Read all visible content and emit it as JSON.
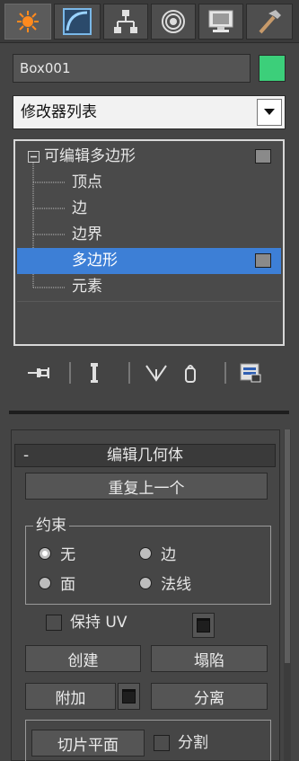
{
  "tabs": [
    {
      "icon": "create-sun-icon",
      "active": true
    },
    {
      "icon": "modify-curve-icon",
      "active": false
    },
    {
      "icon": "hierarchy-icon",
      "active": false
    },
    {
      "icon": "motion-target-icon",
      "active": false
    },
    {
      "icon": "display-monitor-icon",
      "active": false
    },
    {
      "icon": "utilities-hammer-icon",
      "active": false
    }
  ],
  "object": {
    "name": "Box001",
    "color": "#3ccf7a"
  },
  "modifier_list": {
    "label": "修改器列表"
  },
  "stack": {
    "root": "可编辑多边形",
    "items": [
      "顶点",
      "边",
      "边界",
      "多边形",
      "元素"
    ],
    "selected": "多边形"
  },
  "toolbar": [
    "pin-stack-icon",
    "show-end-result-icon",
    "make-unique-icon",
    "remove-modifier-icon",
    "configure-sets-icon"
  ],
  "rollout": {
    "collapse": "-",
    "title": "编辑几何体",
    "repeat_last": "重复上一个",
    "constraint": {
      "label": "约束",
      "options": [
        "无",
        "边",
        "面",
        "法线"
      ],
      "selected": "无"
    },
    "preserve_uv": "保持 UV",
    "create": "创建",
    "collapse_btn": "塌陷",
    "attach": "附加",
    "detach": "分离",
    "slice_plane": "切片平面",
    "split": "分割"
  }
}
